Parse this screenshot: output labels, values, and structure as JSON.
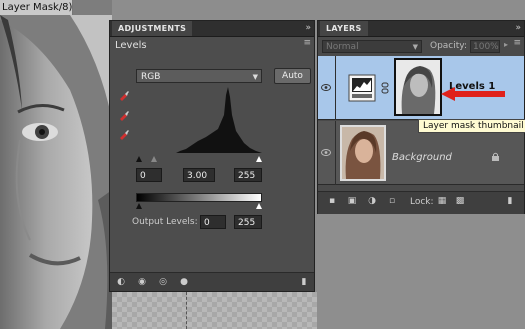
{
  "document": {
    "tab_title": "Layer Mask/8) *"
  },
  "adjustments": {
    "tab_label": "ADJUSTMENTS",
    "title": "Levels",
    "channel": "RGB",
    "auto_label": "Auto",
    "input_black": "0",
    "input_gamma": "3.00",
    "input_white": "255",
    "output_label": "Output Levels:",
    "output_black": "0",
    "output_white": "255"
  },
  "layers": {
    "tab_label": "LAYERS",
    "blend_mode": "Normal",
    "opacity_label": "Opacity:",
    "opacity_value": "100%",
    "lock_label": "Lock:",
    "items": [
      {
        "name": "Levels 1",
        "selected": true
      },
      {
        "name": "Background",
        "locked": true
      }
    ]
  },
  "tooltip": {
    "text": "Layer mask thumbnail"
  },
  "colors": {
    "selection": "#a8c7ea",
    "arrow": "#e0211b",
    "tooltip_bg": "#fffbd2"
  }
}
